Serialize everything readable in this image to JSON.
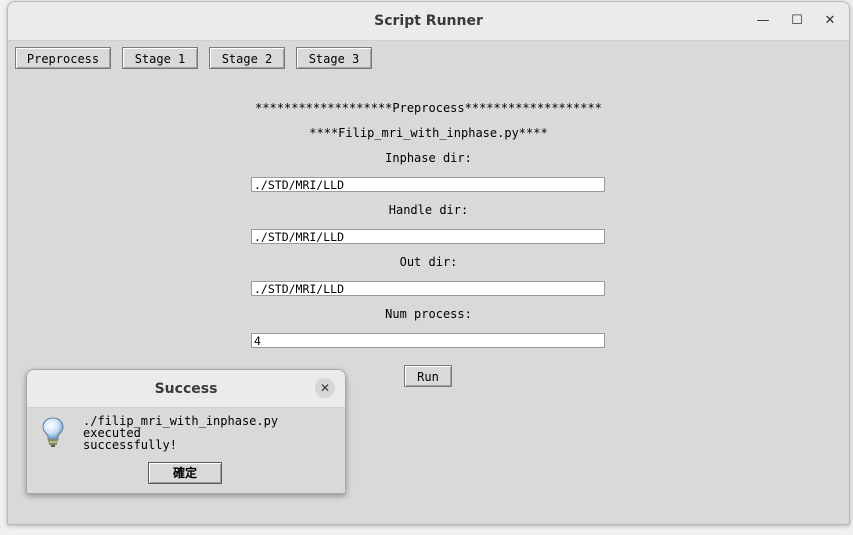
{
  "window": {
    "title": "Script Runner",
    "minimize_glyph": "—",
    "maximize_glyph": "☐",
    "close_glyph": "✕"
  },
  "tabs": [
    "Preprocess",
    "Stage 1",
    "Stage 2",
    "Stage 3"
  ],
  "panel": {
    "header": "*******************Preprocess*******************",
    "script_line": "****Filip_mri_with_inphase.py****",
    "fields": [
      {
        "label": "Inphase dir:",
        "value": "./STD/MRI/LLD"
      },
      {
        "label": "Handle dir:",
        "value": "./STD/MRI/LLD"
      },
      {
        "label": "Out dir:",
        "value": "./STD/MRI/LLD"
      },
      {
        "label": "Num process:",
        "value": "4"
      }
    ],
    "run_label": "Run"
  },
  "dialog": {
    "title": "Success",
    "close_glyph": "✕",
    "icon": "lightbulb-icon",
    "message_line1": "./filip_mri_with_inphase.py executed",
    "message_line2": "successfully!",
    "ok_label": "確定"
  }
}
